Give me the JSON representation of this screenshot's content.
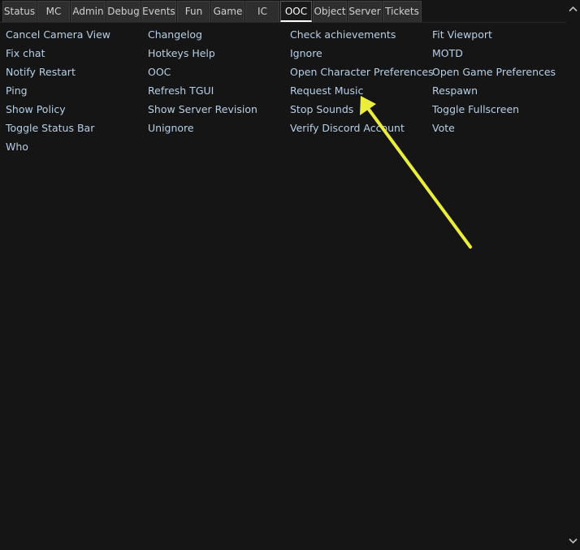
{
  "tabs": [
    {
      "label": "Status",
      "active": false
    },
    {
      "label": "MC",
      "active": false
    },
    {
      "label": "Admin",
      "active": false
    },
    {
      "label": "Debug",
      "active": false
    },
    {
      "label": "Events",
      "active": false
    },
    {
      "label": "Fun",
      "active": false
    },
    {
      "label": "Game",
      "active": false
    },
    {
      "label": "IC",
      "active": false
    },
    {
      "label": "OOC",
      "active": true
    },
    {
      "label": "Object",
      "active": false
    },
    {
      "label": "Server",
      "active": false
    },
    {
      "label": "Tickets",
      "active": false
    }
  ],
  "verbs": [
    "Cancel Camera View",
    "Changelog",
    "Check achievements",
    "Fit Viewport",
    "Fix chat",
    "Hotkeys Help",
    "Ignore",
    "MOTD",
    "Notify Restart",
    "OOC",
    "Open Character Preferences",
    "Open Game Preferences",
    "Ping",
    "Refresh TGUI",
    "Request Music",
    "Respawn",
    "Show Policy",
    "Show Server Revision",
    "Stop Sounds",
    "Toggle Fullscreen",
    "Toggle Status Bar",
    "Unignore",
    "Verify Discord Account",
    "Vote",
    "Who"
  ],
  "colors": {
    "background": "#151515",
    "tab_bg": "#2e2e2e",
    "tab_text": "#cfcfcf",
    "verb_text": "#b8cfe6",
    "annotation_arrow": "#eaee3a"
  },
  "icons": {
    "scroll_up": "chevron-up-icon",
    "scroll_down": "chevron-down-icon",
    "annotation": "arrow-annotation-icon"
  }
}
